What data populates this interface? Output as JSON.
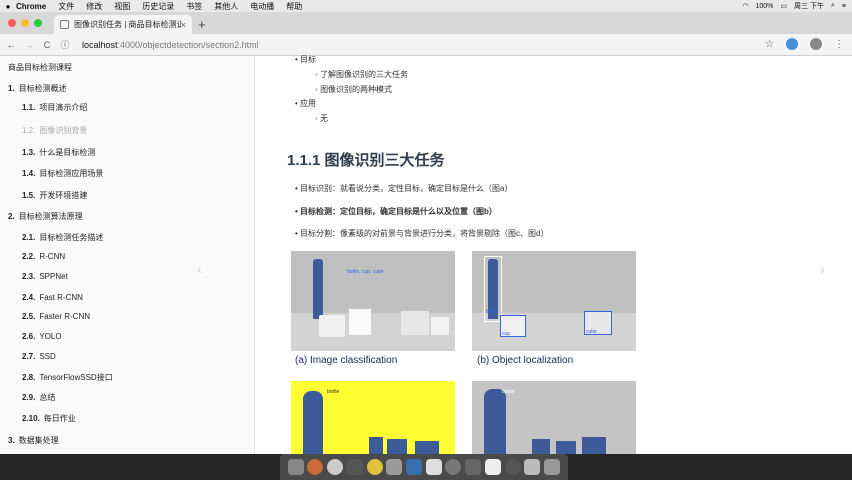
{
  "menubar": {
    "app": "Chrome",
    "items": [
      "文件",
      "修改",
      "视图",
      "历史记录",
      "书签",
      "其他人",
      "电动播",
      "帮助"
    ],
    "battery": "100%",
    "clock": "周三 下午"
  },
  "tab": {
    "title": "图像识别任务 | 商品目标检测识",
    "close": "×"
  },
  "toolbar": {
    "back": "←",
    "forward": "→",
    "reload": "C",
    "url_host": "localhost",
    "url_path": ":4000/objectdetection/section2.html"
  },
  "sidebar": {
    "title": "商品目标检测课程",
    "items": [
      {
        "num": "1.",
        "label": "目标检测概述",
        "dim": false
      },
      {
        "num": "1.1.",
        "label": "项目演示介绍",
        "dim": false
      },
      {
        "num": "1.2.",
        "label": "图像识别背景",
        "dim": true
      },
      {
        "num": "1.3.",
        "label": "什么是目标检测",
        "dim": false
      },
      {
        "num": "1.4.",
        "label": "目标检测应用场景",
        "dim": false
      },
      {
        "num": "1.5.",
        "label": "开发环境搭建",
        "dim": false
      },
      {
        "num": "2.",
        "label": "目标检测算法原理",
        "dim": false
      },
      {
        "num": "2.1.",
        "label": "目标检测任务描述",
        "dim": false
      },
      {
        "num": "2.2.",
        "label": "R-CNN",
        "dim": false
      },
      {
        "num": "2.3.",
        "label": "SPPNet",
        "dim": false
      },
      {
        "num": "2.4.",
        "label": "Fast R-CNN",
        "dim": false
      },
      {
        "num": "2.5.",
        "label": "Faster R-CNN",
        "dim": false
      },
      {
        "num": "2.6.",
        "label": "YOLO",
        "dim": false
      },
      {
        "num": "2.7.",
        "label": "SSD",
        "dim": false
      },
      {
        "num": "2.8.",
        "label": "TensorFlowSSD接口",
        "dim": false
      },
      {
        "num": "2.9.",
        "label": "总结",
        "dim": false
      },
      {
        "num": "2.10.",
        "label": "每日作业",
        "dim": false
      },
      {
        "num": "3.",
        "label": "数据集处理",
        "dim": false
      }
    ]
  },
  "content": {
    "goal_title": "目标",
    "goal_items": [
      "了解图像识别的三大任务",
      "图像识别的两种模式"
    ],
    "apply_title": "应用",
    "apply_items": [
      "无"
    ],
    "heading": "1.1.1 图像识别三大任务",
    "tasks": [
      "目标识别：就看说分类，定性目标，确定目标是什么（图a）",
      "目标检测：定位目标，确定目标是什么以及位置（图b）",
      "目标分割：像素级的对前景与背景进行分类，将背景剔除（图c、图d）"
    ],
    "captions": [
      "(a) Image classification",
      "(b) Object localization"
    ],
    "labels": {
      "a": "bottle, cup, cube",
      "b_bottle": "bottle",
      "b_cup": "cup",
      "b_cube": "cube",
      "c": "bottle",
      "d": "bottle"
    }
  },
  "colors": {
    "accent": "#2c3e50",
    "seg_yellow": "#ffff33",
    "bottle_blue": "#3d5a99"
  }
}
